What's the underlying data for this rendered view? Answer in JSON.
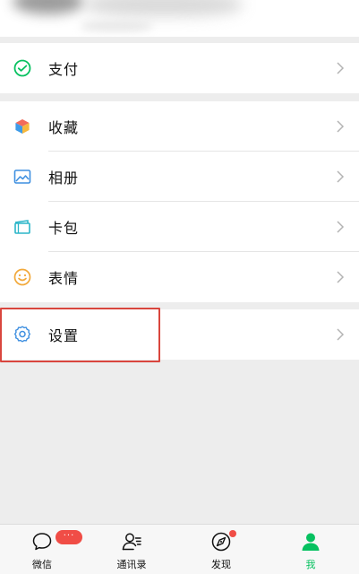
{
  "menu": {
    "pay": {
      "label": "支付",
      "icon": "wechat-pay-icon"
    },
    "favorites": {
      "label": "收藏",
      "icon": "favorites-cube-icon"
    },
    "album": {
      "label": "相册",
      "icon": "album-icon"
    },
    "cards": {
      "label": "卡包",
      "icon": "card-wallet-icon"
    },
    "stickers": {
      "label": "表情",
      "icon": "smiley-icon"
    },
    "settings": {
      "label": "设置",
      "icon": "gear-icon"
    }
  },
  "tabbar": {
    "chats": {
      "label": "微信",
      "badge": "···"
    },
    "contacts": {
      "label": "通讯录"
    },
    "discover": {
      "label": "发现"
    },
    "me": {
      "label": "我"
    }
  },
  "colors": {
    "accent_green": "#07c160",
    "badge_red": "#f04d46",
    "highlight_red": "#d9463e",
    "background": "#ededed"
  }
}
